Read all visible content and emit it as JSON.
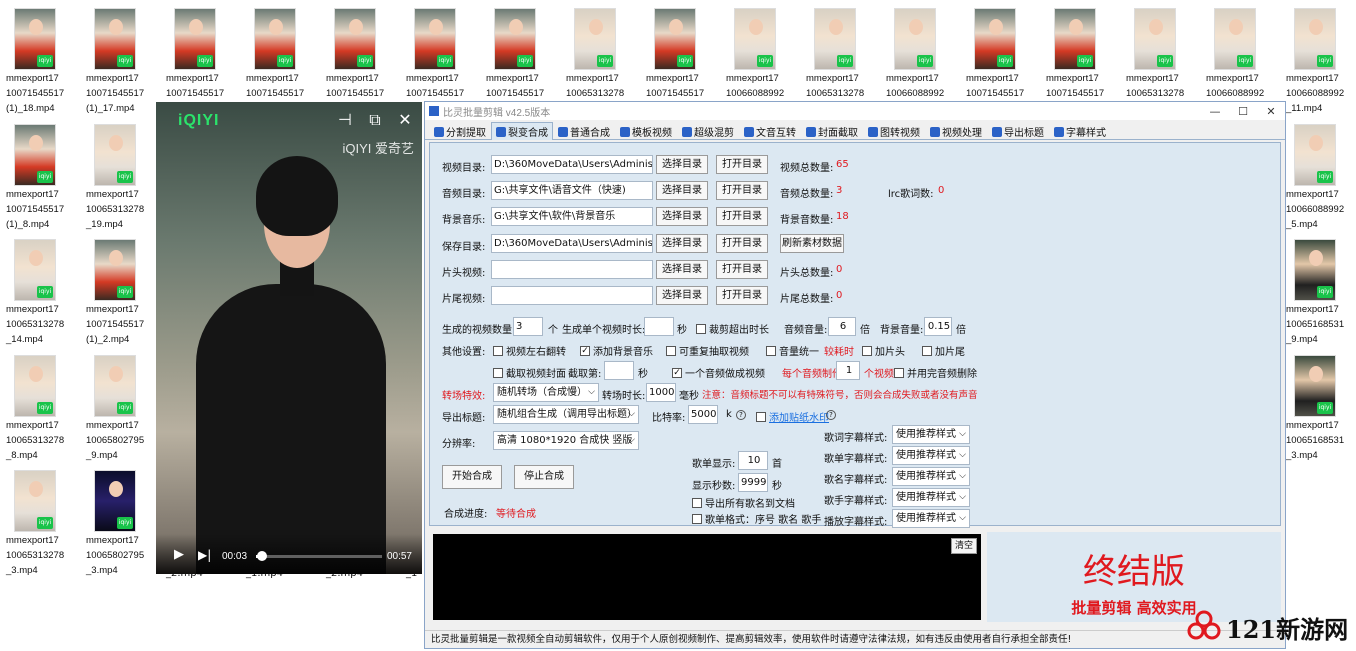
{
  "desktop": {
    "files_row1": [
      {
        "l1": "mmexport17",
        "l2": "10071545517",
        "l3": "(1)_18.mp4"
      },
      {
        "l1": "mmexport17",
        "l2": "10071545517",
        "l3": "(1)_17.mp4"
      },
      {
        "l1": "mmexport17",
        "l2": "10071545517",
        "l3": ""
      },
      {
        "l1": "mmexport17",
        "l2": "10071545517",
        "l3": ""
      },
      {
        "l1": "mmexport17",
        "l2": "10071545517",
        "l3": ""
      },
      {
        "l1": "mmexport17",
        "l2": "10071545517",
        "l3": ""
      },
      {
        "l1": "mmexport17",
        "l2": "10071545517",
        "l3": ""
      },
      {
        "l1": "mmexport17",
        "l2": "10065313278",
        "l3": ""
      },
      {
        "l1": "mmexport17",
        "l2": "10071545517",
        "l3": ""
      },
      {
        "l1": "mmexport17",
        "l2": "10066088992",
        "l3": ""
      },
      {
        "l1": "mmexport17",
        "l2": "10065313278",
        "l3": ""
      },
      {
        "l1": "mmexport17",
        "l2": "10066088992",
        "l3": ""
      },
      {
        "l1": "mmexport17",
        "l2": "10071545517",
        "l3": ""
      },
      {
        "l1": "mmexport17",
        "l2": "10071545517",
        "l3": ""
      },
      {
        "l1": "mmexport17",
        "l2": "10065313278",
        "l3": ""
      },
      {
        "l1": "mmexport17",
        "l2": "10066088992",
        "l3": ""
      },
      {
        "l1": "mmexport17",
        "l2": "10066088992",
        "l3": "_11.mp4"
      }
    ],
    "left_col1": [
      {
        "l1": "mmexport17",
        "l2": "10071545517",
        "l3": "(1)_8.mp4"
      },
      {
        "l1": "mmexport17",
        "l2": "10065313278",
        "l3": "_14.mp4"
      },
      {
        "l1": "mmexport17",
        "l2": "10065313278",
        "l3": "_8.mp4"
      },
      {
        "l1": "mmexport17",
        "l2": "10065313278",
        "l3": "_3.mp4"
      }
    ],
    "left_col2": [
      {
        "l1": "mmexport17",
        "l2": "10065313278",
        "l3": "_19.mp4"
      },
      {
        "l1": "mmexport17",
        "l2": "10071545517",
        "l3": "(1)_2.mp4"
      },
      {
        "l1": "mmexport17",
        "l2": "10065802795",
        "l3": "_9.mp4"
      },
      {
        "l1": "mmexport17",
        "l2": "10065802795",
        "l3": "_3.mp4"
      }
    ],
    "right_col": [
      {
        "l1": "mmexport17",
        "l2": "10066088992",
        "l3": "_5.mp4"
      },
      {
        "l1": "mmexport17",
        "l2": "10065168531",
        "l3": "_9.mp4"
      },
      {
        "l1": "mmexport17",
        "l2": "10065168531",
        "l3": "_3.mp4"
      }
    ],
    "behind_player_labels": [
      "_2.mp4",
      "_1.mp4",
      "_2.mp4",
      "_1"
    ]
  },
  "player": {
    "logo": "iQIYI",
    "watermark": "iQIYI 爱奇艺",
    "current_time": "00:03",
    "total_time": "00:57",
    "progress": 0.05
  },
  "app": {
    "title": "比灵批量剪辑    v42.5版本",
    "tabs": [
      "分割提取",
      "裂变合成",
      "普通合成",
      "模板视频",
      "超级混剪",
      "文音互转",
      "封面截取",
      "图转视频",
      "视频处理",
      "导出标题",
      "字幕样式"
    ],
    "active_tab": "裂变合成",
    "rows": {
      "video_dir": {
        "label": "视频目录:",
        "value": "D:\\360MoveData\\Users\\Administrato",
        "count_label": "视频总数量:",
        "count": "65"
      },
      "audio_dir": {
        "label": "音频目录:",
        "value": "G:\\共享文件\\语音文件（快速)",
        "count_label": "音频总数量:",
        "count": "3",
        "lrc_label": "lrc歌词数:",
        "lrc": "0"
      },
      "bgm_dir": {
        "label": "背景音乐:",
        "value": "G:\\共享文件\\软件\\背景音乐",
        "count_label": "背景音数量:",
        "count": "18"
      },
      "save_dir": {
        "label": "保存目录:",
        "value": "D:\\360MoveData\\Users\\Administrato",
        "refresh": "刷新素材数据"
      },
      "head_dir": {
        "label": "片头视频:",
        "value": "",
        "count_label": "片头总数量:",
        "count": "0"
      },
      "tail_dir": {
        "label": "片尾视频:",
        "value": "",
        "count_label": "片尾总数量:",
        "count": "0"
      }
    },
    "btn_select": "选择目录",
    "btn_open": "打开目录",
    "gen_count_label": "生成的视频数量:",
    "gen_count": "3",
    "unit_ge": "个",
    "single_dur_label": "生成单个视频时长:",
    "single_dur": "",
    "unit_sec": "秒",
    "cut_overlong": "裁剪超出时长",
    "audio_vol_label": "音频音量:",
    "audio_vol": "6",
    "unit_bei": "倍",
    "bg_vol_label": "背景音量:",
    "bg_vol": "0.15",
    "other_label": "其他设置:",
    "opt_flip": "视频左右翻转",
    "opt_bgm": "添加背景音乐",
    "opt_repeat": "可重复抽取视频",
    "opt_norm": "音量统一",
    "opt_norm_note": "较耗时",
    "opt_add_head": "加片头",
    "opt_add_tail": "加片尾",
    "opt_cover": "截取视频封面",
    "cover_frame_label": "截取第:",
    "cover_frame": "",
    "opt_one_audio": "一个音频做成视频",
    "per_audio_label": "每个音频制作:",
    "per_audio": "1",
    "per_audio_unit": "个视频",
    "opt_delete": "并用完音频删除",
    "transition_label": "转场特效:",
    "transition_value": "随机转场（合成慢）",
    "transition_dur_label": "转场时长:",
    "transition_dur": "1000",
    "unit_ms": "毫秒",
    "warning": "注意：音频标题不可以有特殊符号，否则会合成失败或者没有声音",
    "export_title_label": "导出标题:",
    "export_title_value": "随机组合生成（调用导出标题）",
    "bitrate_label": "比特率:",
    "bitrate": "5000",
    "bitrate_unit": "k",
    "opt_sticker": "添加贴纸水印",
    "resolution_label": "分辨率:",
    "resolution_value": "高清 1080*1920 合成快 竖版",
    "lyric_style_label": "歌词字幕样式:",
    "songlist_style_label": "歌单字幕样式:",
    "songname_style_label": "歌名字幕样式:",
    "singer_style_label": "歌手字幕样式:",
    "play_style_label": "播放字幕样式:",
    "style_value": "使用推荐样式",
    "songlist_show_label": "歌单显示:",
    "songlist_show": "10",
    "unit_shou": "首",
    "show_secs_label": "显示秒数:",
    "show_secs": "99999",
    "opt_export_names": "导出所有歌名到文档",
    "opt_format": "歌单格式：序号 歌名 歌手",
    "btn_start": "开始合成",
    "btn_stop": "停止合成",
    "progress_label": "合成进度:",
    "progress_value": "等待合成",
    "clear_btn": "清空",
    "promo_big": "终结版",
    "promo_sub": "批量剪辑 高效实用",
    "status": "比灵批量剪辑是一款视频全自动剪辑软件，仅用于个人原创视频制作、提高剪辑效率，使用软件时请遵守法律法规，如有违反由使用者自行承担全部责任!"
  },
  "site_watermark": "121新游网",
  "colors": {
    "accent": "#e0191f",
    "panel": "#dce8f2",
    "iqiyi_green": "#2be36b"
  }
}
